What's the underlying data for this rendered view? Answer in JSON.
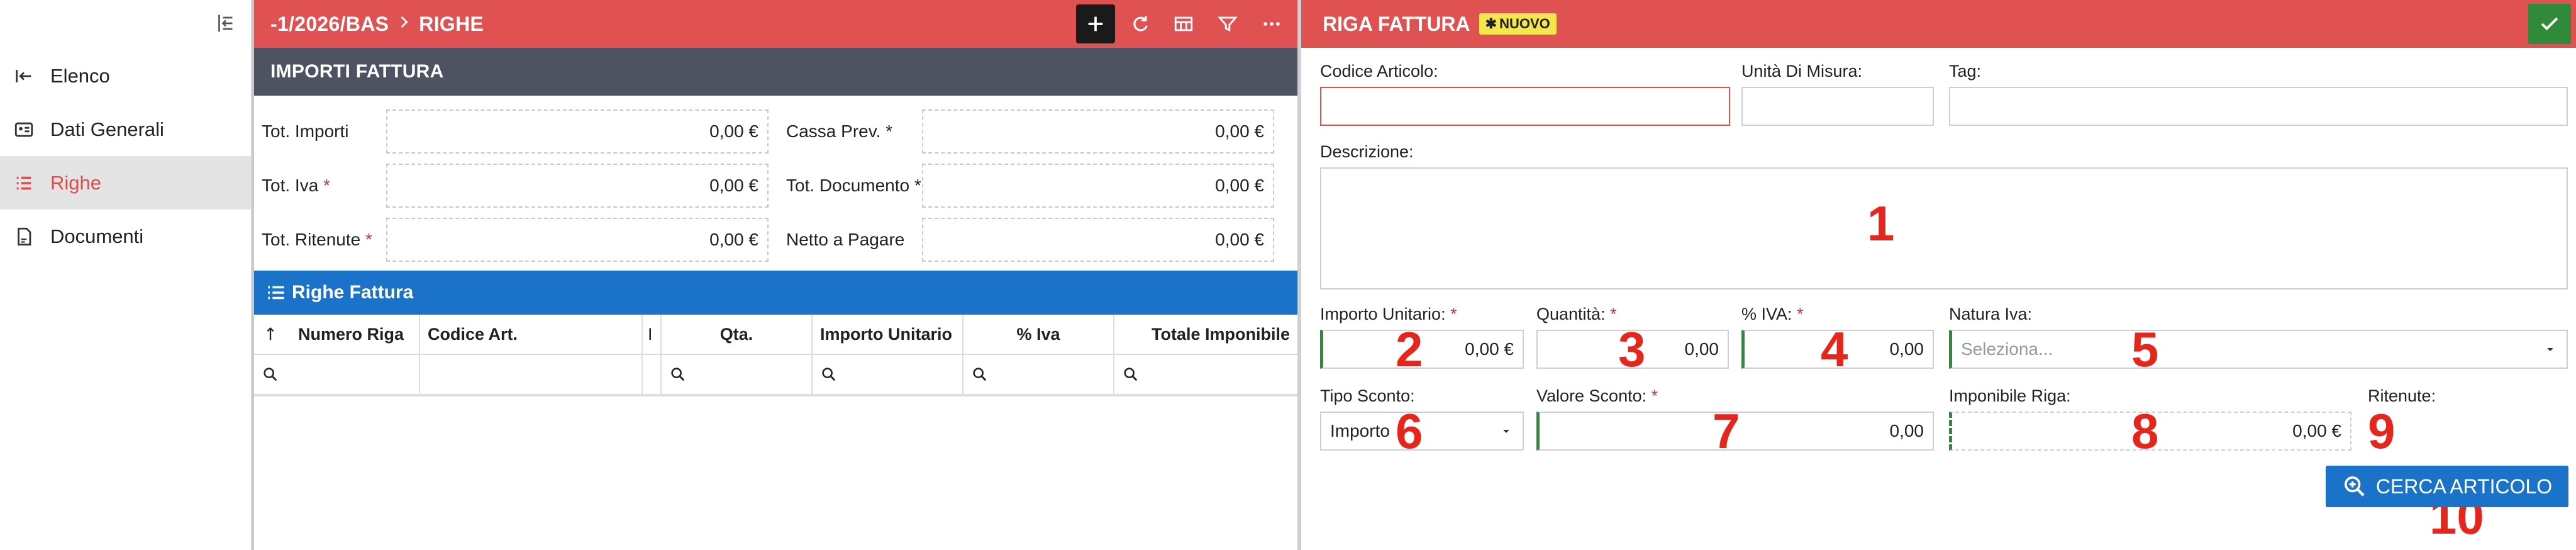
{
  "sidebar": {
    "items": [
      {
        "label": "Elenco",
        "icon": "back-arrow-icon"
      },
      {
        "label": "Dati Generali",
        "icon": "id-card-icon"
      },
      {
        "label": "Righe",
        "icon": "list-icon",
        "active": true
      },
      {
        "label": "Documenti",
        "icon": "pdf-document-icon"
      }
    ]
  },
  "left": {
    "breadcrumb_doc": "-1/2026/BAS",
    "breadcrumb_section": "RIGHE",
    "section_totals_title": "IMPORTI FATTURA",
    "totals": {
      "tot_importi_label": "Tot. Importi",
      "tot_importi_value": "0,00 €",
      "cassa_prev_label": "Cassa Prev.",
      "cassa_prev_value": "0,00 €",
      "tot_iva_label": "Tot. Iva",
      "tot_iva_value": "0,00 €",
      "tot_documento_label": "Tot. Documento",
      "tot_documento_value": "0,00 €",
      "tot_ritenute_label": "Tot. Ritenute",
      "tot_ritenute_value": "0,00 €",
      "netto_label": "Netto a Pagare",
      "netto_value": "0,00 €"
    },
    "section_rows_title": "Righe Fattura",
    "columns": [
      "Numero Riga",
      "Codice Art.",
      "I",
      "Qta.",
      "Importo Unitario",
      "% Iva",
      "Totale Imponibile"
    ]
  },
  "right": {
    "title": "RIGA FATTURA",
    "badge": "NUOVO",
    "labels": {
      "codice_articolo": "Codice Articolo:",
      "unita_misura": "Unità Di Misura:",
      "tag": "Tag:",
      "descrizione": "Descrizione:",
      "importo_unitario": "Importo Unitario:",
      "quantita": "Quantità:",
      "perc_iva": "% IVA:",
      "natura_iva": "Natura Iva:",
      "tipo_sconto": "Tipo Sconto:",
      "valore_sconto": "Valore Sconto:",
      "imponibile_riga": "Imponibile Riga:",
      "ritenute": "Ritenute:"
    },
    "values": {
      "importo_unitario": "0,00 €",
      "quantita": "0,00",
      "perc_iva": "0,00",
      "natura_iva_placeholder": "Seleziona...",
      "tipo_sconto": "Importo",
      "valore_sconto": "0,00",
      "imponibile_riga": "0,00 €"
    },
    "search_button": "CERCA ARTICOLO",
    "markers": [
      "1",
      "2",
      "3",
      "4",
      "5",
      "6",
      "7",
      "8",
      "9",
      "10"
    ]
  }
}
